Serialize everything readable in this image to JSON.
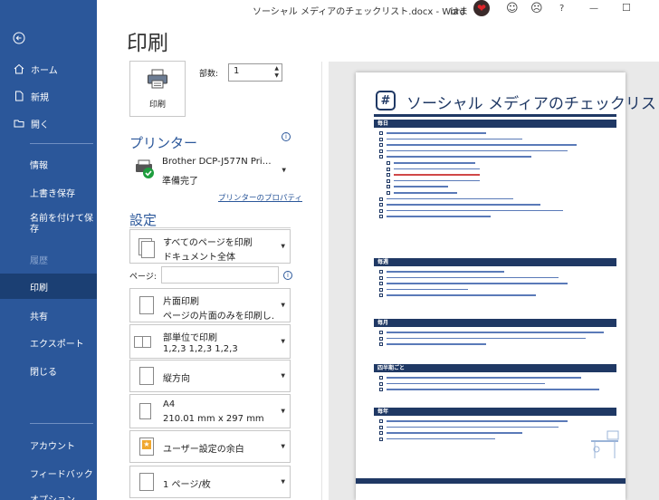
{
  "titlebar": {
    "title": "ソーシャル メディアのチェックリスト.docx  -  Word",
    "user": "はま",
    "icons": [
      "heart-avatar",
      "smiley-icon",
      "frown-icon",
      "help-icon",
      "minimize-icon",
      "maximize-icon"
    ],
    "help": "?",
    "minimize": "—",
    "maximize": "☐"
  },
  "sidebar": {
    "back": "back-arrow-icon",
    "items": {
      "home": "ホーム",
      "new": "新規",
      "open": "開く",
      "info": "情報",
      "save": "上書き保存",
      "saveas": "名前を付けて保存",
      "browse": "履歴",
      "print": "印刷",
      "share": "共有",
      "export": "エクスポート",
      "close": "閉じる",
      "account": "アカウント",
      "feedback": "フィードバック",
      "options": "オプション"
    }
  },
  "page_title": "印刷",
  "print_button": {
    "label": "印刷"
  },
  "copies": {
    "label": "部数:",
    "value": "1"
  },
  "printer": {
    "header": "プリンター",
    "name": "Brother DCP-J577N Pri…",
    "status": "準備完了",
    "properties_link": "プリンターのプロパティ",
    "info": "i"
  },
  "settings": {
    "header": "設定",
    "what": {
      "line1": "すべてのページを印刷",
      "line2": "ドキュメント全体"
    },
    "pages_label": "ページ:",
    "pages_value": "",
    "pages_info": "i",
    "sides": {
      "line1": "片面印刷",
      "line2": "ページの片面のみを印刷し…"
    },
    "collate": {
      "line1": "部単位で印刷",
      "line2": "1,2,3    1,2,3    1,2,3"
    },
    "orientation": {
      "line1": "縦方向"
    },
    "paper": {
      "line1": "A4",
      "line2": "210.01 mm x 297 mm"
    },
    "margins": {
      "line1": "ユーザー設定の余白"
    },
    "pages_per_sheet": {
      "line1": "1 ページ/枚"
    }
  },
  "preview": {
    "hash": "#",
    "doc_title": "ソーシャル メディアのチェックリスト",
    "sections": [
      "毎日",
      "毎週",
      "毎月",
      "四半期ごと",
      "毎年"
    ]
  },
  "colors": {
    "sidebar": "#2b579a",
    "sidebar_active": "#1b3f73",
    "doc_navy": "#1f3864"
  }
}
